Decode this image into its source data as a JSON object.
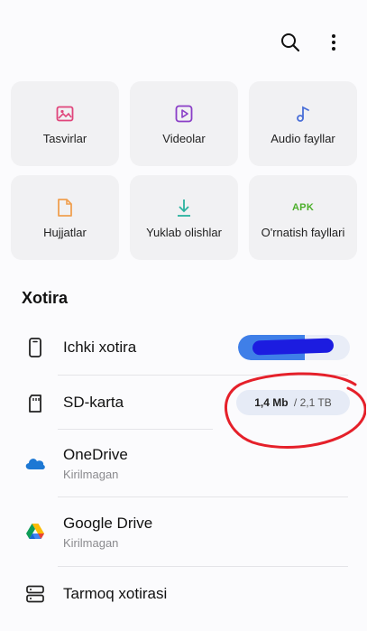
{
  "categories": [
    {
      "label": "Tasvirlar",
      "icon": "image-icon"
    },
    {
      "label": "Videolar",
      "icon": "video-icon"
    },
    {
      "label": "Audio fayllar",
      "icon": "music-note-icon"
    },
    {
      "label": "Hujjatlar",
      "icon": "document-icon"
    },
    {
      "label": "Yuklab olishlar",
      "icon": "download-icon"
    },
    {
      "label": "O'rnatish fayllari",
      "icon": "apk-icon",
      "icon_text": "APK"
    }
  ],
  "storage": {
    "title": "Xotira",
    "internal": {
      "label": "Ichki xotira",
      "used_fraction": 0.6
    },
    "sd": {
      "label": "SD-karta",
      "used": "1,4 Mb",
      "separator": " / ",
      "total": "2,1 TB"
    },
    "onedrive": {
      "label": "OneDrive",
      "status": "Kirilmagan"
    },
    "gdrive": {
      "label": "Google Drive",
      "status": "Kirilmagan"
    },
    "network": {
      "label": "Tarmoq xotirasi"
    }
  },
  "colors": {
    "accent": "#3f7fe8",
    "image_icon": "#e0457b",
    "video_icon": "#8a3ec7",
    "audio_icon": "#4a6fd8",
    "doc_icon": "#f0a050",
    "download_icon": "#2bb3a0",
    "apk_icon": "#4caf2a",
    "annotation": "#e5202a"
  }
}
